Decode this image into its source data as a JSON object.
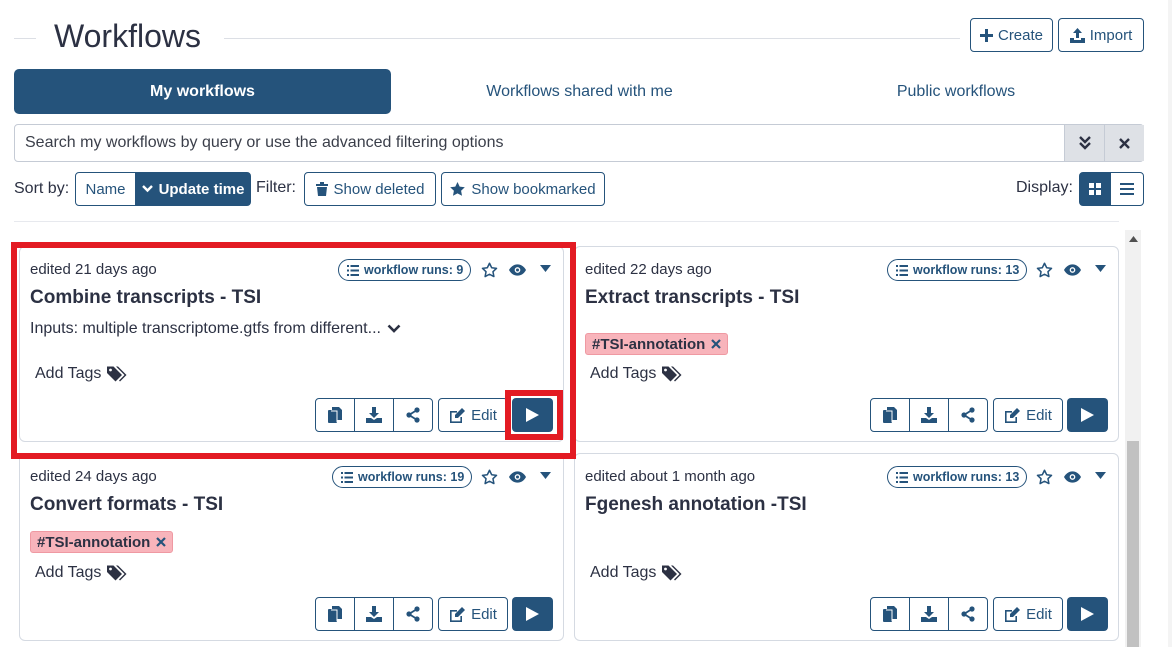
{
  "header": {
    "title": "Workflows",
    "create_label": "Create",
    "import_label": "Import"
  },
  "tabs": [
    {
      "label": "My workflows",
      "active": true
    },
    {
      "label": "Workflows shared with me",
      "active": false
    },
    {
      "label": "Public workflows",
      "active": false
    }
  ],
  "search": {
    "placeholder": "Search my workflows by query or use the advanced filtering options"
  },
  "sort": {
    "label": "Sort by:",
    "options": [
      "Name",
      "Update time"
    ],
    "selected": "Update time"
  },
  "filter": {
    "label": "Filter:",
    "show_deleted": "Show deleted",
    "show_bookmarked": "Show bookmarked"
  },
  "display": {
    "label": "Display:"
  },
  "cards": [
    {
      "edited": "edited 21 days ago",
      "runs": "workflow runs: 9",
      "name": "Combine transcripts - TSI",
      "description": "Inputs: multiple transcriptome.gtfs from different...",
      "tag": "",
      "add_tags": "Add Tags",
      "edit": "Edit"
    },
    {
      "edited": "edited 22 days ago",
      "runs": "workflow runs: 13",
      "name": "Extract transcripts - TSI",
      "description": "",
      "tag": "#TSI-annotation",
      "add_tags": "Add Tags",
      "edit": "Edit"
    },
    {
      "edited": "edited 24 days ago",
      "runs": "workflow runs: 19",
      "name": "Convert formats - TSI",
      "description": "",
      "tag": "#TSI-annotation",
      "add_tags": "Add Tags",
      "edit": "Edit"
    },
    {
      "edited": "edited about 1 month ago",
      "runs": "workflow runs: 13",
      "name": "Fgenesh annotation -TSI",
      "description": "",
      "tag": "",
      "add_tags": "Add Tags",
      "edit": "Edit"
    }
  ],
  "colors": {
    "primary": "#25537b",
    "tag_bg": "#f8b4bb",
    "highlight": "#e31b23"
  }
}
